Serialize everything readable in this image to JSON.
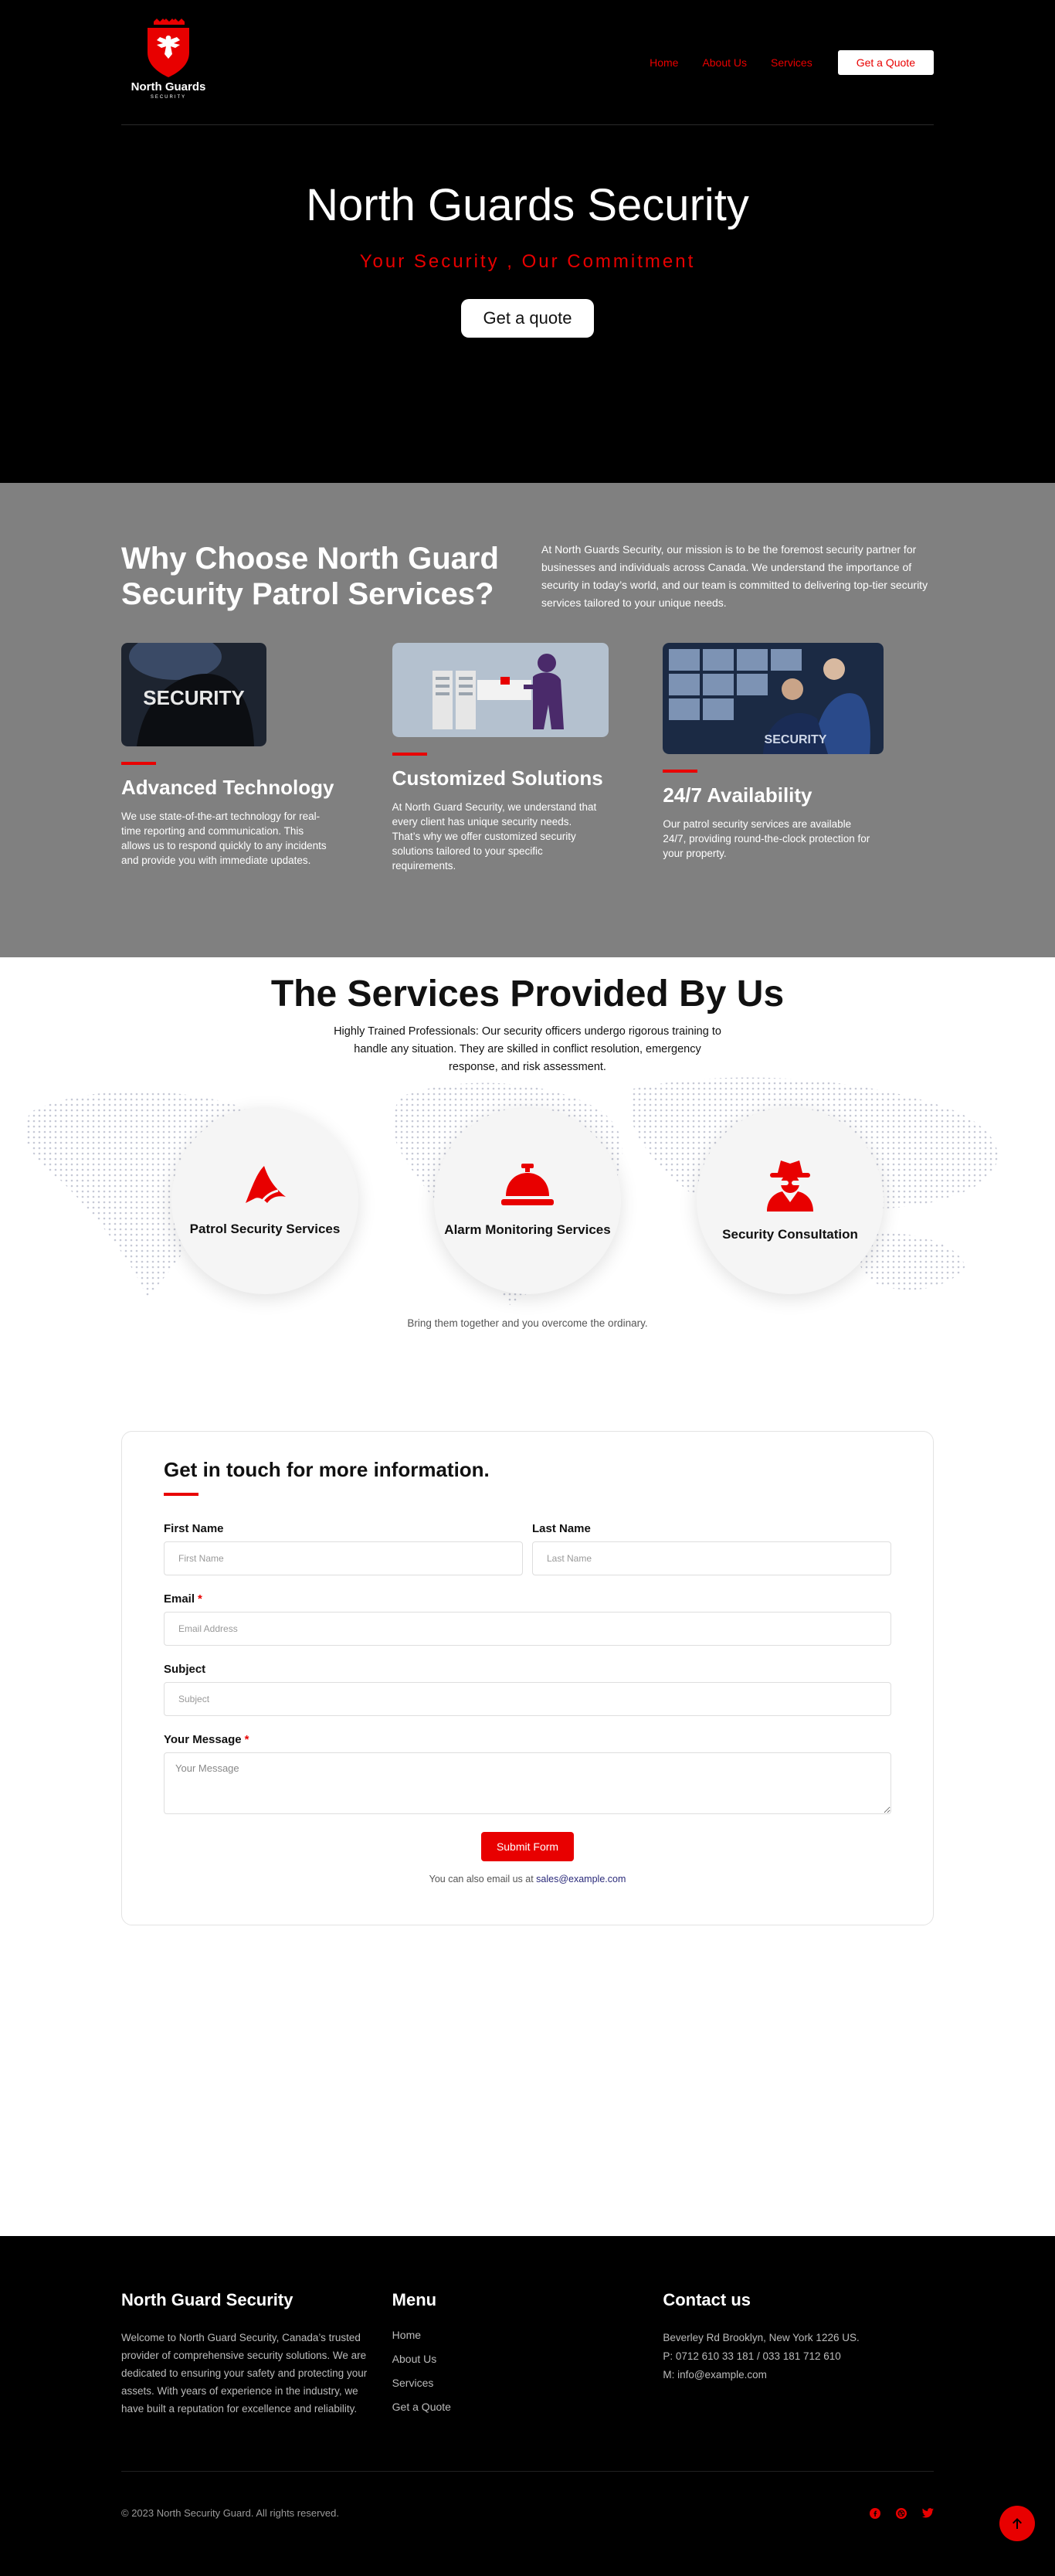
{
  "header": {
    "logo_name": "North Guards",
    "logo_sub": "SECURITY",
    "nav": [
      "Home",
      "About Us",
      "Services"
    ],
    "cta": "Get a Quote"
  },
  "hero": {
    "title": "North Guards Security",
    "subtitle": "Your Security , Our Commitment",
    "button": "Get a quote"
  },
  "why": {
    "title": "Why Choose North Guard Security Patrol Services?",
    "text": "At North Guards Security, our mission is to be the foremost security partner for businesses and individuals across Canada. We understand the importance of security in today’s world, and our team is committed to delivering top-tier security services tailored to your unique needs.",
    "features": [
      {
        "title": "Advanced Technology",
        "text": "We use state-of-the-art technology for real-time reporting and communication. This allows us to respond quickly to any incidents and provide you with immediate updates.",
        "image_label": "SECURITY"
      },
      {
        "title": "Customized Solutions",
        "text": "At North Guard Security, we understand that every client has unique security needs. That’s why we offer customized security solutions tailored to your specific requirements."
      },
      {
        "title": "24/7 Availability",
        "text": "Our patrol security services are available 24/7, providing round-the-clock protection for your property.",
        "image_label": "SECURITY"
      }
    ]
  },
  "services": {
    "title": "The Services Provided By Us",
    "description": "Highly Trained Professionals: Our security officers undergo rigorous training to handle any situation. They are skilled in conflict resolution, emergency response, and risk assessment.",
    "items": [
      {
        "label": "Patrol Security Services",
        "icon": "shark-fin-icon"
      },
      {
        "label": "Alarm Monitoring Services",
        "icon": "service-bell-icon"
      },
      {
        "label": "Security Consultation",
        "icon": "user-secret-icon"
      }
    ],
    "footnote": "Bring them together and you overcome the ordinary."
  },
  "contact": {
    "title": "Get in touch for more information.",
    "first_name_label": "First Name",
    "first_name_placeholder": "First Name",
    "last_name_label": "Last Name",
    "last_name_placeholder": "Last Name",
    "email_label": "Email",
    "email_placeholder": "Email Address",
    "subject_label": "Subject",
    "subject_placeholder": "Subject",
    "message_label": "Your Message",
    "message_placeholder": "Your Message",
    "required_mark": "*",
    "submit": "Submit Form",
    "email_note": "You can also email us at",
    "email_link": "sales@example.com"
  },
  "footer": {
    "about_title": "North Guard Security",
    "about_text": "Welcome to North Guard Security, Canada’s trusted provider of comprehensive security solutions. We are dedicated to ensuring your safety and protecting your assets. With years of experience in the industry, we have built a reputation for excellence and reliability.",
    "menu_title": "Menu",
    "menu": [
      "Home",
      "About Us",
      "Services",
      "Get a Quote"
    ],
    "contact_title": "Contact us",
    "address": "Beverley Rd Brooklyn, New York 1226 US.",
    "phone": "P: 0712 610 33 181 / 033 181 712 610",
    "email": "M: info@example.com",
    "copyright": "© 2023 North Security Guard. All rights reserved."
  },
  "colors": {
    "accent": "#e80000",
    "hero_bg": "#000000",
    "why_bg": "#808080",
    "footer_bg": "#000000"
  }
}
